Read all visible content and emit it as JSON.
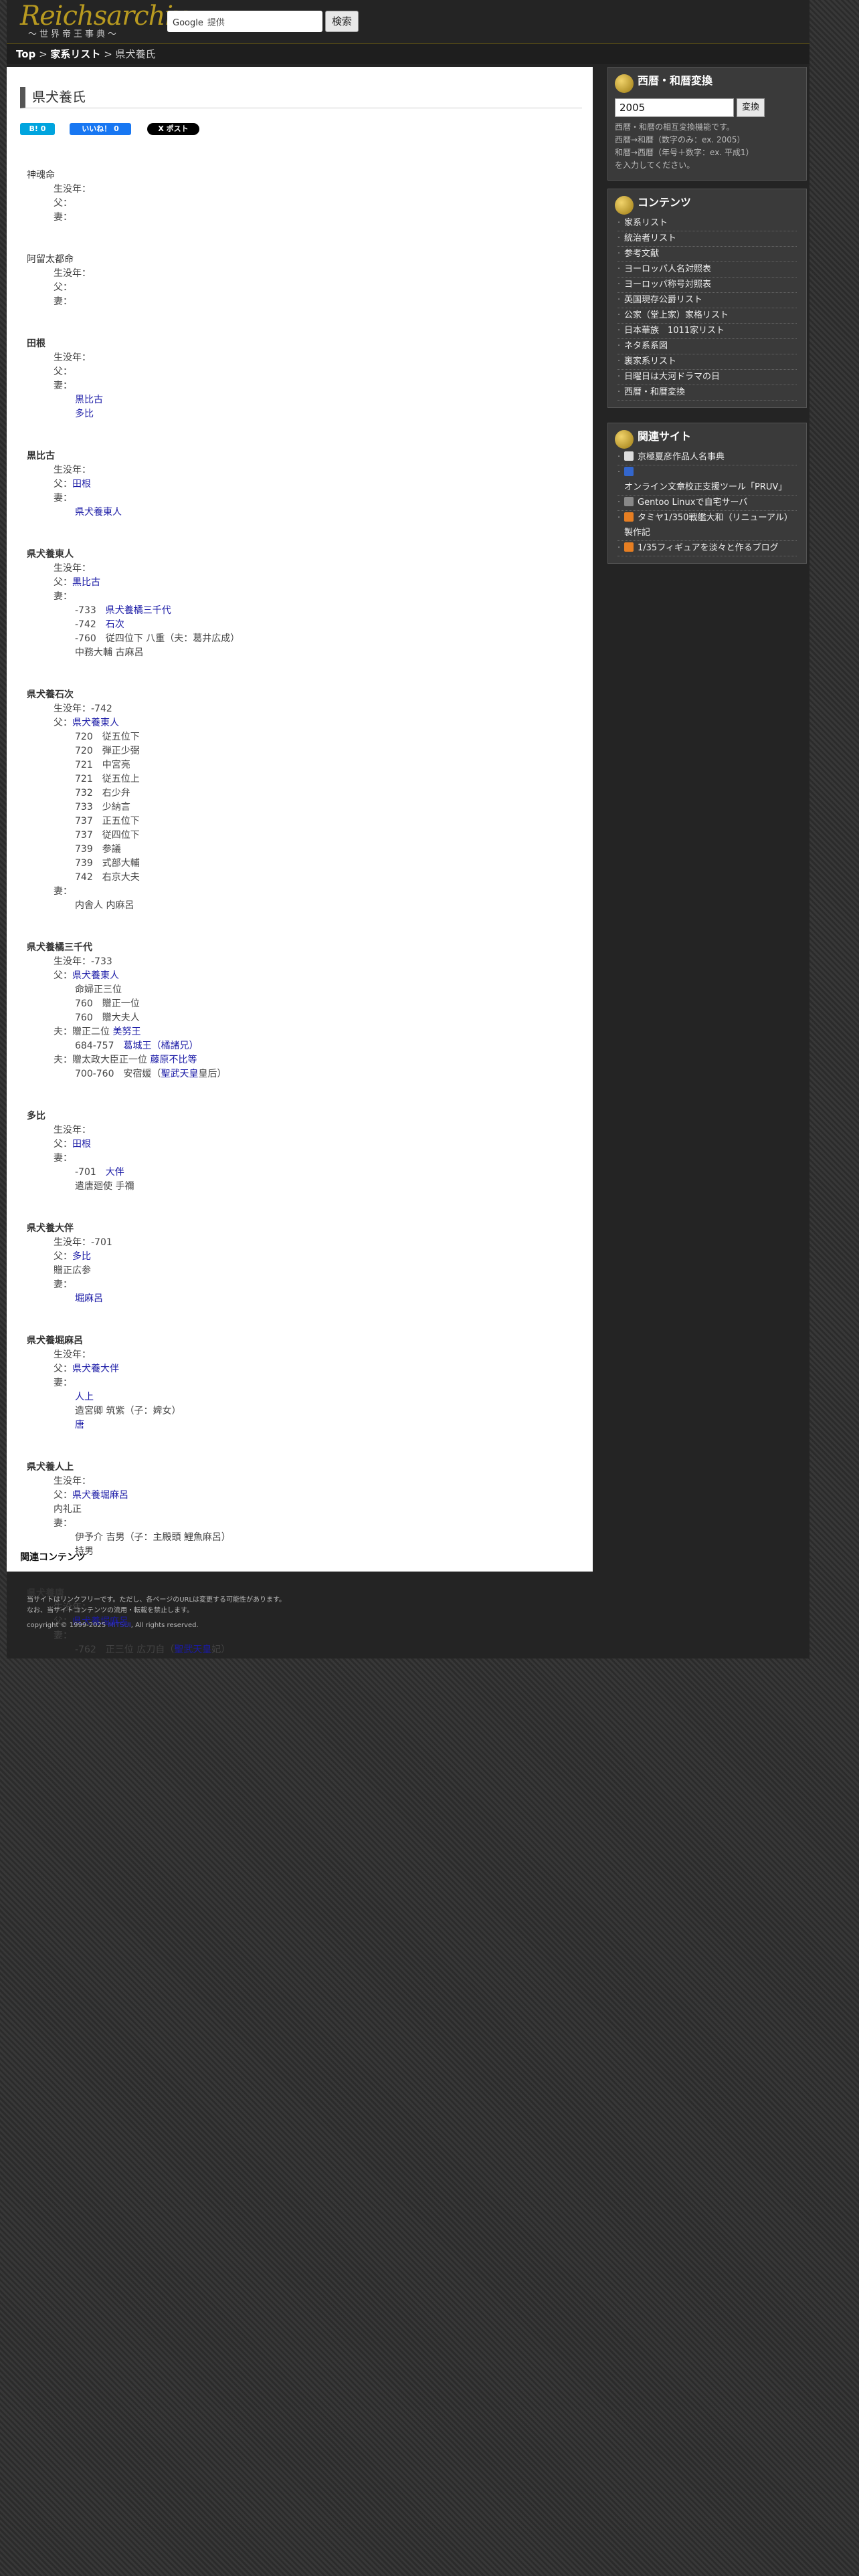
{
  "header": {
    "logo_line1": "Reichsarchiv",
    "logo_line2": "〜世界帝王事典〜",
    "search_brand": "Google",
    "search_value": "提供",
    "search_button": "検索"
  },
  "breadcrumb": {
    "top": "Top",
    "list": "家系リスト",
    "current": "県犬養氏"
  },
  "page": {
    "title": "県犬養氏",
    "related_heading": "関連コンテンツ"
  },
  "share": {
    "hatena": "B! 0",
    "like": "いいね！ 0",
    "post": "X ポスト"
  },
  "entries": [
    {
      "name": "神魂命",
      "bold": false,
      "fields": [
        "生没年：",
        "父：",
        "妻："
      ],
      "items": []
    },
    {
      "name": "阿留太都命",
      "bold": false,
      "fields": [
        "生没年：",
        "父：",
        "妻："
      ],
      "items": []
    },
    {
      "name": "田根",
      "bold": true,
      "fields": [
        "生没年：",
        "父：",
        "妻："
      ],
      "items": [
        {
          "t": "黒比古",
          "link": true
        },
        {
          "t": "多比",
          "link": true
        }
      ]
    },
    {
      "name": "黒比古",
      "bold": true,
      "fields": [
        "生没年：",
        "父：田根",
        "妻："
      ],
      "items": [
        {
          "t": "県犬養東人",
          "link": true
        }
      ]
    },
    {
      "name": "県犬養東人",
      "bold": true,
      "fields": [
        "生没年：",
        "父：黒比古",
        "妻："
      ],
      "items": [
        {
          "t": "-733　県犬養橘三千代",
          "link": true
        },
        {
          "t": "-742　石次",
          "link": true
        },
        {
          "t": "-760　従四位下 八重（夫：葛井広成）",
          "link": false
        },
        {
          "t": "中務大輔 古麻呂",
          "link": false
        }
      ]
    },
    {
      "name": "県犬養石次",
      "bold": true,
      "fields": [
        "生没年：-742",
        "父：県犬養東人"
      ],
      "items": [
        {
          "t": "720　従五位下",
          "link": false
        },
        {
          "t": "720　弾正少弼",
          "link": false
        },
        {
          "t": "721　中宮亮",
          "link": false
        },
        {
          "t": "721　従五位上",
          "link": false
        },
        {
          "t": "732　右少弁",
          "link": false
        },
        {
          "t": "733　少納言",
          "link": false
        },
        {
          "t": "737　正五位下",
          "link": false
        },
        {
          "t": "737　従四位下",
          "link": false
        },
        {
          "t": "739　参議",
          "link": false
        },
        {
          "t": "739　式部大輔",
          "link": false
        },
        {
          "t": "742　右京大夫",
          "link": false
        }
      ],
      "fields2": [
        "妻："
      ],
      "items2": [
        {
          "t": "内舎人 内麻呂",
          "link": false
        }
      ]
    },
    {
      "name": "県犬養橘三千代",
      "bold": true,
      "fields": [
        "生没年：-733",
        "父：県犬養東人"
      ],
      "items": [
        {
          "t": "命婦正三位",
          "link": false
        },
        {
          "t": "760　贈正一位",
          "link": false
        },
        {
          "t": "760　贈大夫人",
          "link": false
        }
      ],
      "fields2": [
        "夫：贈正二位 美努王"
      ],
      "items2": [
        {
          "t": "684-757　葛城王（橘諸兄）",
          "link": true
        }
      ],
      "fields3": [
        "夫：贈太政大臣正一位 藤原不比等"
      ],
      "items3": [
        {
          "t": "700-760　安宿媛（聖武天皇皇后）",
          "link": false
        }
      ]
    },
    {
      "name": "多比",
      "bold": true,
      "fields": [
        "生没年：",
        "父：田根",
        "妻："
      ],
      "items": [
        {
          "t": "-701　大伴",
          "link": true
        },
        {
          "t": "遣唐廻使 手禰",
          "link": false
        }
      ]
    },
    {
      "name": "県犬養大伴",
      "bold": true,
      "fields": [
        "生没年：-701",
        "父：多比",
        "贈正広参",
        "妻："
      ],
      "items": [
        {
          "t": "堀麻呂",
          "link": true
        }
      ]
    },
    {
      "name": "県犬養堀麻呂",
      "bold": true,
      "fields": [
        "生没年：",
        "父：県犬養大伴",
        "妻："
      ],
      "items": [
        {
          "t": "人上",
          "link": true
        },
        {
          "t": "造宮卿 筑紫（子：婢女）",
          "link": false
        },
        {
          "t": "唐",
          "link": true
        }
      ]
    },
    {
      "name": "県犬養人上",
      "bold": true,
      "fields": [
        "生没年：",
        "父：県犬養堀麻呂",
        "内礼正",
        "妻："
      ],
      "items": [
        {
          "t": "伊予介 吉男（子：主殿頭 鯉魚麻呂）",
          "link": false
        },
        {
          "t": "持男",
          "link": false
        }
      ]
    },
    {
      "name": "県犬養唐",
      "bold": true,
      "fields": [
        "生没年：",
        "父：県犬養堀麻呂",
        "妻："
      ],
      "items": [
        {
          "t": "-762　正三位 広刀自（聖武天皇妃）",
          "link": false
        }
      ]
    }
  ],
  "sidebar": {
    "converter": {
      "title": "西暦・和暦変換",
      "value": "2005",
      "button": "変換",
      "note1": "西暦・和暦の相互変換機能です。",
      "note2": "西暦→和暦（数字のみ：ex. 2005）",
      "note3": "和暦→西暦（年号＋数字：ex. 平成1）",
      "note4": "を入力してください。"
    },
    "contents": {
      "title": "コンテンツ",
      "items": [
        "家系リスト",
        "統治者リスト",
        "参考文献",
        "ヨーロッパ人名対照表",
        "ヨーロッパ称号対照表",
        "英国現存公爵リスト",
        "公家（堂上家）家格リスト",
        "日本華族　1011家リスト",
        "ネタ系系図",
        "裏家系リスト",
        "日曜日は大河ドラマの日",
        "西暦・和暦変換"
      ]
    },
    "related": {
      "title": "関連サイト",
      "items": [
        "京極夏彦作品人名事典",
        "オンライン文章校正支援ツール「PRUV」",
        "Gentoo Linuxで自宅サーバ",
        "タミヤ1/350戦艦大和（リニューアル）製作記",
        "1/35フィギュアを淡々と作るブログ"
      ]
    }
  },
  "footer": {
    "l1": "当サイトはリンクフリーです。ただし、各ページのURLは変更する可能性があります。",
    "l2": "なお、当サイトコンテンツの流用・転載を禁止します。",
    "l3": "copyright © 1999-2025 ",
    "owner": "MITSUI",
    "l4": ", All rights reserved."
  },
  "colors": {
    "link": "#1a1aa6",
    "bg": "#242424",
    "accent": "#b89a20"
  }
}
